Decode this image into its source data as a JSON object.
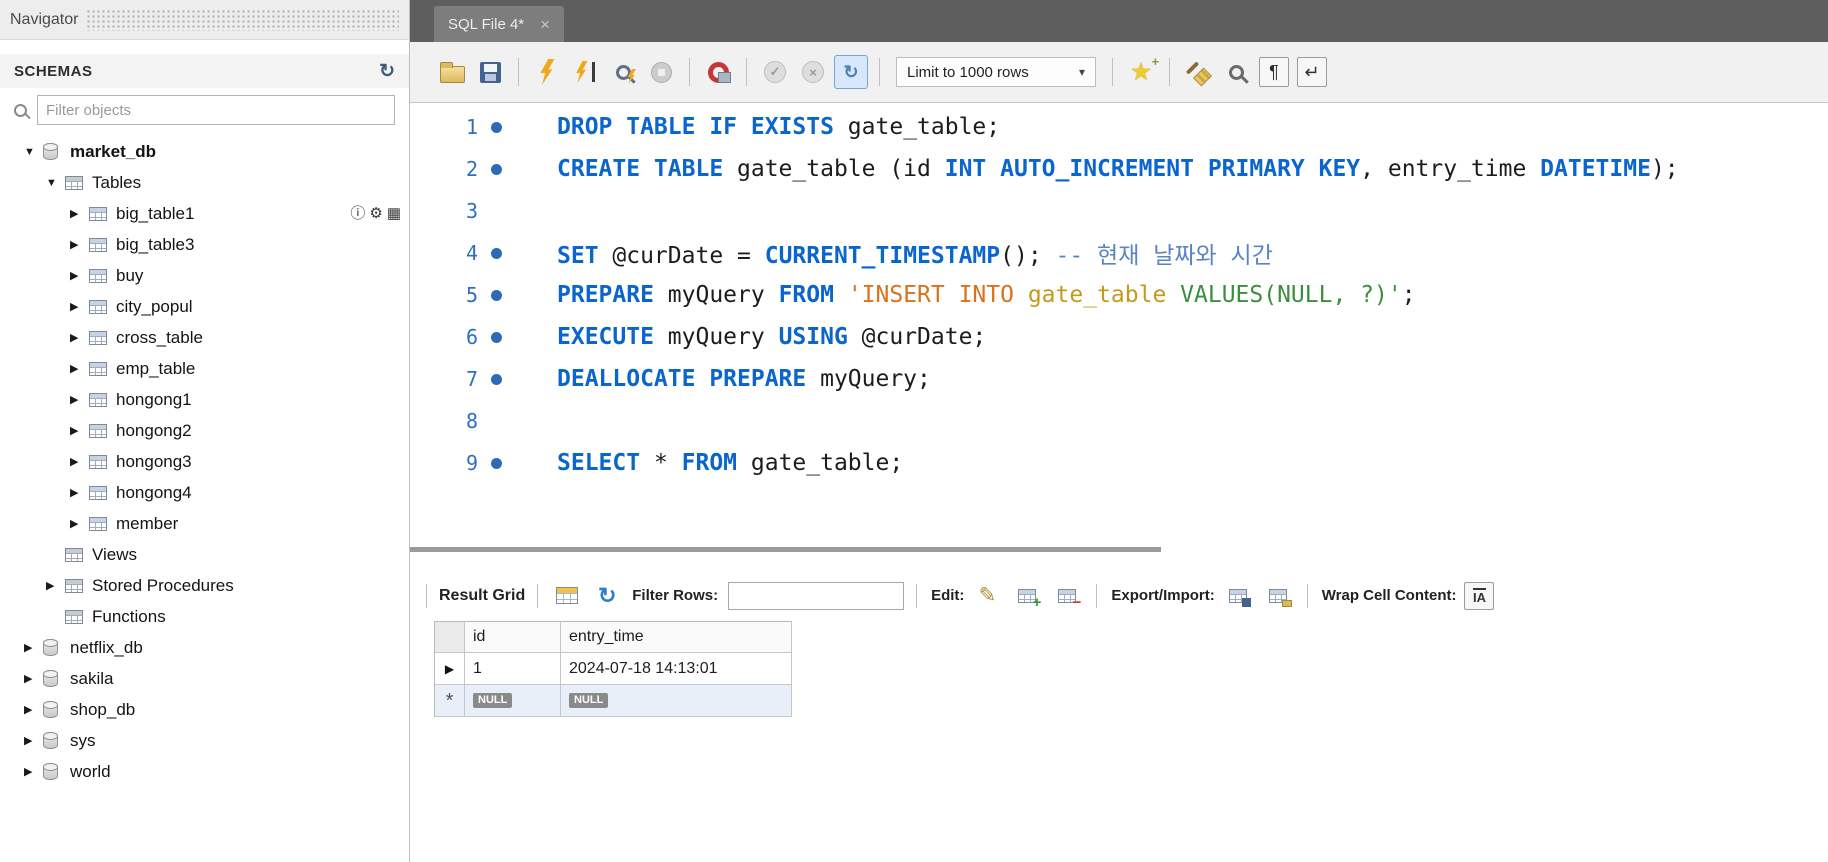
{
  "colors": {
    "keyword_blue": "#0a66cc",
    "string_orange": "#d9721c",
    "string_yellow": "#c59a1a",
    "string_green": "#3a8f3c",
    "comment_blue": "#5b84c4",
    "line_number_blue": "#2e6fbe",
    "tabbar_gray": "#5e5e5e",
    "null_badge_gray": "#8a8a8a",
    "alt_row_blue": "#e9eff8"
  },
  "icons": {
    "arrow_expanded": "▼",
    "arrow_collapsed": "▶",
    "dropdown_arrow": "▾",
    "tab_close": "×",
    "refresh_glyph": "↻",
    "pencil_glyph": "✎",
    "pilcrow_glyph": "¶",
    "wrap_glyph": "↵",
    "star_glyph": "★",
    "check_glyph": "✓",
    "cross_glyph": "×",
    "info_glyph": "ⓘ",
    "gear_glyph": "⚙",
    "edit_table_glyph": "▦",
    "wrap_cell_glyph": "IA"
  },
  "sidebar": {
    "title": "Navigator",
    "schemas_header": "SCHEMAS",
    "filter_placeholder": "Filter objects",
    "tree": [
      {
        "label": "market_db",
        "level": 0,
        "icon": "schema",
        "arrow": "down",
        "bold": true
      },
      {
        "label": "Tables",
        "level": 1,
        "icon": "group",
        "arrow": "down"
      },
      {
        "label": "big_table1",
        "level": 2,
        "icon": "table",
        "arrow": "right",
        "actions": true
      },
      {
        "label": "big_table3",
        "level": 2,
        "icon": "table",
        "arrow": "right"
      },
      {
        "label": "buy",
        "level": 2,
        "icon": "table",
        "arrow": "right"
      },
      {
        "label": "city_popul",
        "level": 2,
        "icon": "table",
        "arrow": "right"
      },
      {
        "label": "cross_table",
        "level": 2,
        "icon": "table",
        "arrow": "right"
      },
      {
        "label": "emp_table",
        "level": 2,
        "icon": "table",
        "arrow": "right"
      },
      {
        "label": "hongong1",
        "level": 2,
        "icon": "table",
        "arrow": "right"
      },
      {
        "label": "hongong2",
        "level": 2,
        "icon": "table",
        "arrow": "right"
      },
      {
        "label": "hongong3",
        "level": 2,
        "icon": "table",
        "arrow": "right"
      },
      {
        "label": "hongong4",
        "level": 2,
        "icon": "table",
        "arrow": "right"
      },
      {
        "label": "member",
        "level": 2,
        "icon": "table",
        "arrow": "right"
      },
      {
        "label": "Views",
        "level": 1,
        "icon": "group",
        "arrow": "none"
      },
      {
        "label": "Stored Procedures",
        "level": 1,
        "icon": "group",
        "arrow": "right"
      },
      {
        "label": "Functions",
        "level": 1,
        "icon": "group",
        "arrow": "none"
      },
      {
        "label": "netflix_db",
        "level": 0,
        "icon": "schema",
        "arrow": "right"
      },
      {
        "label": "sakila",
        "level": 0,
        "icon": "schema",
        "arrow": "right"
      },
      {
        "label": "shop_db",
        "level": 0,
        "icon": "schema",
        "arrow": "right"
      },
      {
        "label": "sys",
        "level": 0,
        "icon": "schema",
        "arrow": "right"
      },
      {
        "label": "world",
        "level": 0,
        "icon": "schema",
        "arrow": "right"
      }
    ]
  },
  "editor": {
    "tab_title": "SQL File 4*",
    "toolbar": {
      "limit_dropdown": "Limit to 1000 rows"
    },
    "lines": [
      {
        "num": "1",
        "dot": true,
        "tokens": [
          {
            "c": "k",
            "t": "DROP TABLE IF EXISTS"
          },
          {
            "c": "p",
            "t": " gate_table;"
          }
        ]
      },
      {
        "num": "2",
        "dot": true,
        "tokens": [
          {
            "c": "k",
            "t": "CREATE TABLE"
          },
          {
            "c": "p",
            "t": " gate_table (id "
          },
          {
            "c": "k",
            "t": "INT AUTO_INCREMENT PRIMARY KEY"
          },
          {
            "c": "p",
            "t": ", entry_time "
          },
          {
            "c": "k",
            "t": "DATETIME"
          },
          {
            "c": "p",
            "t": ");"
          }
        ]
      },
      {
        "num": "3",
        "dot": false,
        "tokens": []
      },
      {
        "num": "4",
        "dot": true,
        "tokens": [
          {
            "c": "k",
            "t": "SET"
          },
          {
            "c": "p",
            "t": " @curDate = "
          },
          {
            "c": "k",
            "t": "CURRENT_TIMESTAMP"
          },
          {
            "c": "p",
            "t": "(); "
          },
          {
            "c": "c",
            "t": "-- 현재 날짜와 시간"
          }
        ]
      },
      {
        "num": "5",
        "dot": true,
        "tokens": [
          {
            "c": "k",
            "t": "PREPARE"
          },
          {
            "c": "p",
            "t": " myQuery "
          },
          {
            "c": "k",
            "t": "FROM"
          },
          {
            "c": "p",
            "t": " "
          },
          {
            "c": "o",
            "t": "'INSERT INTO "
          },
          {
            "c": "y",
            "t": "gate_table"
          },
          {
            "c": "g",
            "t": " VALUES(NULL, ?)'"
          },
          {
            "c": "p",
            "t": ";"
          }
        ]
      },
      {
        "num": "6",
        "dot": true,
        "tokens": [
          {
            "c": "k",
            "t": "EXECUTE"
          },
          {
            "c": "p",
            "t": " myQuery "
          },
          {
            "c": "k",
            "t": "USING"
          },
          {
            "c": "p",
            "t": " @curDate;"
          }
        ]
      },
      {
        "num": "7",
        "dot": true,
        "tokens": [
          {
            "c": "k",
            "t": "DEALLOCATE PREPARE"
          },
          {
            "c": "p",
            "t": " myQuery;"
          }
        ]
      },
      {
        "num": "8",
        "dot": false,
        "tokens": []
      },
      {
        "num": "9",
        "dot": true,
        "tokens": [
          {
            "c": "k",
            "t": "SELECT"
          },
          {
            "c": "p",
            "t": " * "
          },
          {
            "c": "k",
            "t": "FROM"
          },
          {
            "c": "p",
            "t": " gate_table;"
          }
        ]
      }
    ]
  },
  "results": {
    "toolbar": {
      "title": "Result Grid",
      "filter_label": "Filter Rows:",
      "filter_value": "",
      "edit_label": "Edit:",
      "export_label": "Export/Import:",
      "wrap_label": "Wrap Cell Content:"
    },
    "table": {
      "columns": [
        "id",
        "entry_time"
      ],
      "rows": [
        {
          "marker": "▶",
          "cells": [
            {
              "text": "1",
              "null": false
            },
            {
              "text": "2024-07-18 14:13:01",
              "null": false
            }
          ]
        },
        {
          "marker": "*",
          "cells": [
            {
              "text": "NULL",
              "null": true
            },
            {
              "text": "NULL",
              "null": true
            }
          ]
        }
      ]
    }
  }
}
